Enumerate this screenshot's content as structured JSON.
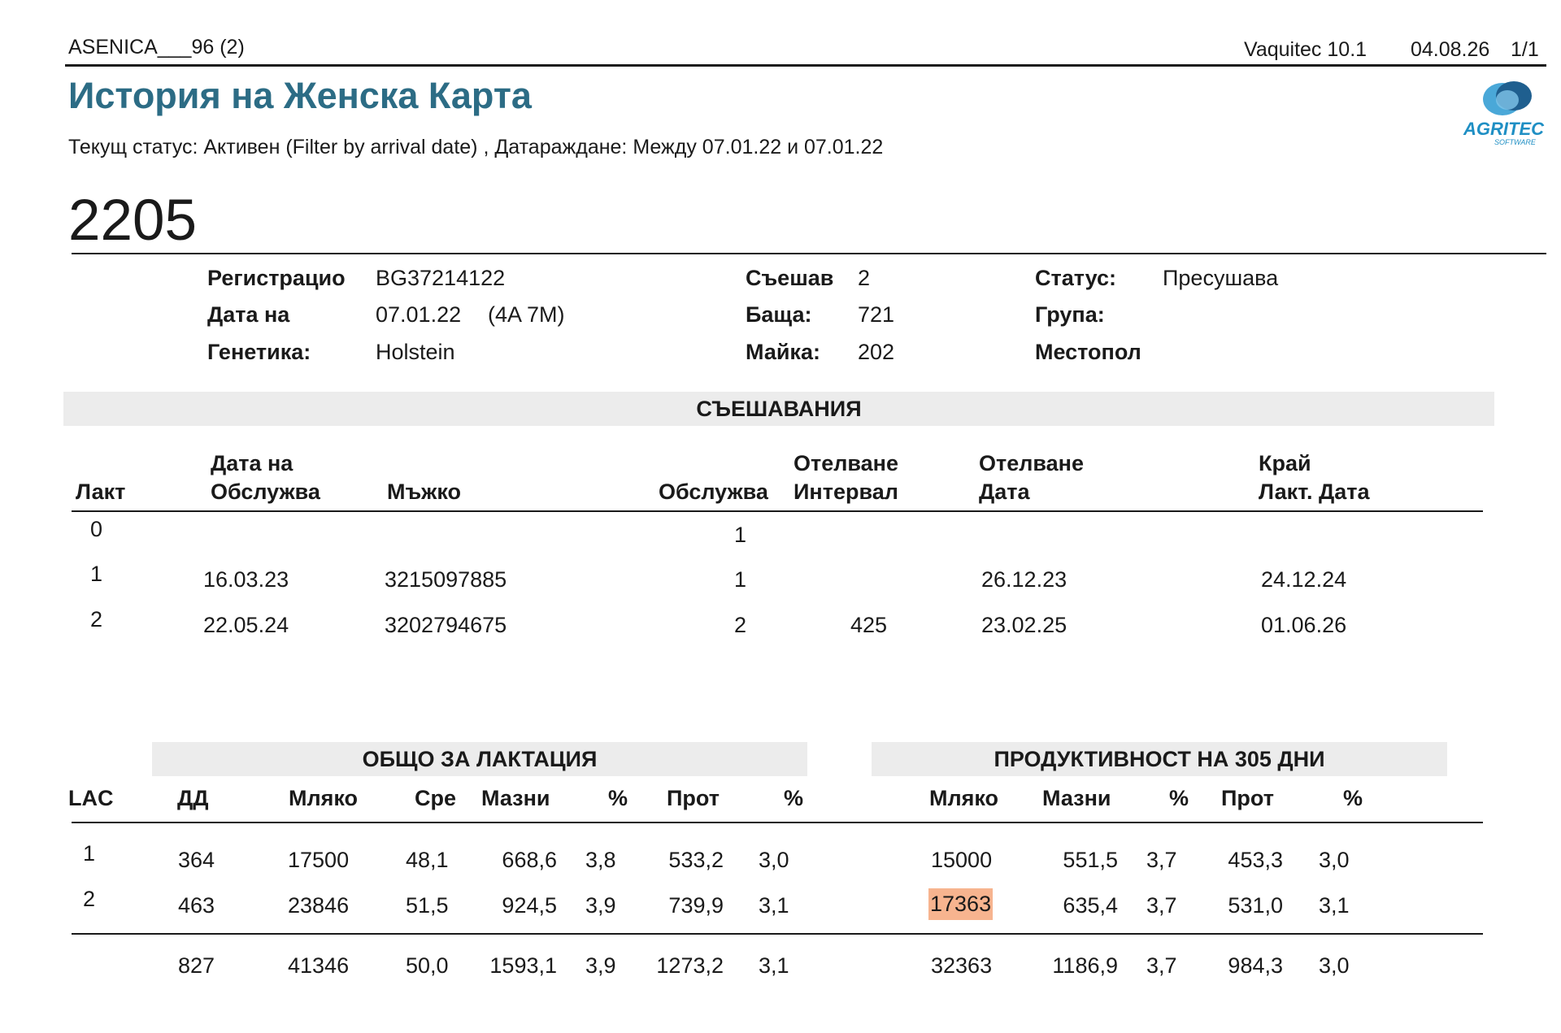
{
  "header": {
    "file_name": "ASENICA___96 (2)",
    "software": "Vaquitec 10.1",
    "date": "04.08.26",
    "page": "1/1"
  },
  "title": "История на Женска Карта",
  "filter_text": "Текущ статус: Активен (Filter by arrival date) , Датараждане:  Между 07.01.22 и 07.01.22",
  "logo": {
    "text": "AGRITEC",
    "subtext": "SOFTWARE",
    "color": "#1f8fc4"
  },
  "animal_id": "2205",
  "info": {
    "registration_label": "Регистрацио",
    "registration_value": "BG37214122",
    "birth_label": "Дата на",
    "birth_value": "07.01.22",
    "birth_age": "(4A 7M)",
    "genetics_label": "Генетика:",
    "genetics_value": "Holstein",
    "matings_label": "Съешав",
    "matings_value": "2",
    "father_label": "Баща:",
    "father_value": "721",
    "mother_label": "Майка:",
    "mother_value": "202",
    "status_label": "Статус:",
    "status_value": "Пресушава",
    "group_label": "Група:",
    "location_label": "Местопол"
  },
  "matings": {
    "section_title": "СЪЕШАВАНИЯ",
    "headers": {
      "lact": "Лакт",
      "service_date_1": "Дата на",
      "service_date_2": "Обслужва",
      "male": "Мъжко",
      "service": "Обслужва",
      "calving_interval_1": "Отелване",
      "calving_interval_2": "Интервал",
      "calving_date_1": "Отелване",
      "calving_date_2": "Дата",
      "end_lact_1": "Край",
      "end_lact_2": "Лакт. Дата"
    },
    "rows": [
      {
        "lact": "0",
        "service_date": "",
        "male": "",
        "service": "1",
        "interval": "",
        "calving_date": "",
        "end_date": ""
      },
      {
        "lact": "1",
        "service_date": "16.03.23",
        "male": "3215097885",
        "service": "1",
        "interval": "",
        "calving_date": "26.12.23",
        "end_date": "24.12.24"
      },
      {
        "lact": "2",
        "service_date": "22.05.24",
        "male": "3202794675",
        "service": "2",
        "interval": "425",
        "calving_date": "23.02.25",
        "end_date": "01.06.26"
      }
    ]
  },
  "production": {
    "total_title": "ОБЩО ЗА ЛАКТАЦИЯ",
    "p305_title": "ПРОДУКТИВНОСТ НА 305 ДНИ",
    "headers": {
      "lac": "LAC",
      "dd": "ДД",
      "milk": "Мляко",
      "avg": "Сре",
      "fat": "Мазни",
      "fat_pct": "%",
      "prot": "Прот",
      "prot_pct": "%",
      "p_milk": "Мляко",
      "p_fat": "Мазни",
      "p_fat_pct": "%",
      "p_prot": "Прот",
      "p_prot_pct": "%"
    },
    "highlight_color": "#f7b48f",
    "rows": [
      {
        "lac": "1",
        "dd": "364",
        "milk": "17500",
        "avg": "48,1",
        "fat": "668,6",
        "fat_pct": "3,8",
        "prot": "533,2",
        "prot_pct": "3,0",
        "p_milk": "15000",
        "p_fat": "551,5",
        "p_fat_pct": "3,7",
        "p_prot": "453,3",
        "p_prot_pct": "3,0"
      },
      {
        "lac": "2",
        "dd": "463",
        "milk": "23846",
        "avg": "51,5",
        "fat": "924,5",
        "fat_pct": "3,9",
        "prot": "739,9",
        "prot_pct": "3,1",
        "p_milk": "17363",
        "p_fat": "635,4",
        "p_fat_pct": "3,7",
        "p_prot": "531,0",
        "p_prot_pct": "3,1"
      }
    ],
    "totals": {
      "dd": "827",
      "milk": "41346",
      "avg": "50,0",
      "fat": "1593,1",
      "fat_pct": "3,9",
      "prot": "1273,2",
      "prot_pct": "3,1",
      "p_milk": "32363",
      "p_fat": "1186,9",
      "p_fat_pct": "3,7",
      "p_prot": "984,3",
      "p_prot_pct": "3,0"
    }
  }
}
